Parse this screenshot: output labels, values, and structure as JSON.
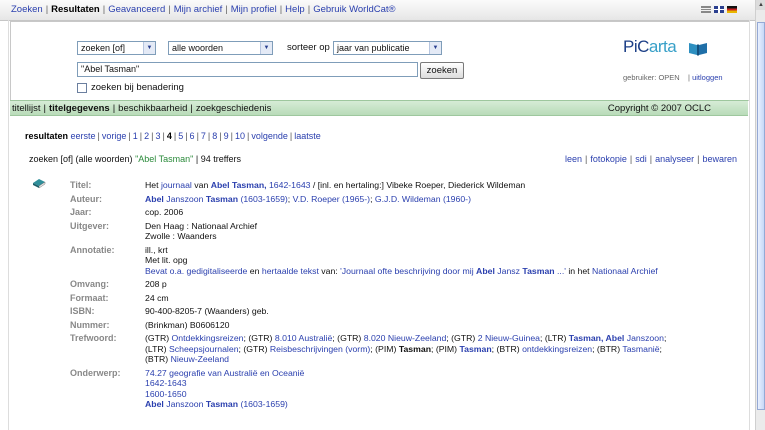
{
  "menu": {
    "items": [
      "Zoeken",
      "Resultaten",
      "Geavanceerd",
      "Mijn archief",
      "Mijn profiel",
      "Help",
      "Gebruik WorldCat®"
    ],
    "current": "Resultaten"
  },
  "search": {
    "mode": "zoeken [of]",
    "words": "alle woorden",
    "sort_label": "sorteer op",
    "sort": "jaar van publicatie",
    "query": "\"Abel Tasman\"",
    "button": "zoeken",
    "approx_label": "zoeken bij benadering"
  },
  "logo": {
    "text_a": "PiC",
    "text_b": "arta"
  },
  "user": {
    "label": "gebruiker:",
    "value": "OPEN",
    "logout": "uitloggen"
  },
  "tabs": [
    "titellijst",
    "titelgegevens",
    "beschikbaarheid",
    "zoekgeschiedenis"
  ],
  "tabs_current": "titelgegevens",
  "copyright": "Copyright © 2007 OCLC",
  "result_nav": {
    "label": "resultaten",
    "first": "eerste",
    "prev": "vorige",
    "pages": [
      "1",
      "2",
      "3",
      "4",
      "5",
      "6",
      "7",
      "8",
      "9",
      "10"
    ],
    "current": "4",
    "next": "volgende",
    "last": "laatste"
  },
  "query_line": {
    "prefix": "zoeken [of] (alle woorden)",
    "query": "\"Abel Tasman\"",
    "hits": "94 treffers"
  },
  "actions": [
    "leen",
    "fotokopie",
    "sdi",
    "analyseer",
    "bewaren"
  ],
  "record": {
    "titel_label": "Titel:",
    "titel": {
      "pre": "Het ",
      "link": "journaal",
      "mid": " van ",
      "b1": "Abel Tasman,",
      "dates": " 1642-1643",
      "post": " / [inl. en hertaling:] Vibeke Roeper, Diederick Wildeman"
    },
    "auteur_label": "Auteur:",
    "auteur": {
      "b1": "Abel",
      "a1": " Janszoon ",
      "b2": "Tasman",
      "a2": " (1603-1659)",
      "sep1": "; ",
      "a3": "V.D. Roeper (1965-)",
      "sep2": "; ",
      "a4": "G.J.D. Wildeman (1960-)"
    },
    "jaar_label": "Jaar:",
    "jaar": "cop. 2006",
    "uitgever_label": "Uitgever:",
    "uitgever": [
      "Den Haag : Nationaal Archief",
      "Zwolle : Waanders"
    ],
    "annotatie_label": "Annotatie:",
    "annotatie": [
      "ill., krt",
      "Met lit. opg"
    ],
    "annotatie_link": {
      "a": "Bevat o.a. gedigitaliseerde",
      "en": " en ",
      "b": "hertaalde tekst",
      "van": " van: ",
      "c1": "'Journaal ofte beschrijving door mij ",
      "cb1": "Abel",
      "c2": " Jansz ",
      "cb2": "Tasman",
      "c3": " ...'",
      "in": " in het ",
      "d": "Nationaal Archief"
    },
    "omvang_label": "Omvang:",
    "omvang": "208 p",
    "formaat_label": "Formaat:",
    "formaat": "24 cm",
    "isbn_label": "ISBN:",
    "isbn": "90-400-8205-7 (Waanders) geb.",
    "nummer_label": "Nummer:",
    "nummer": "(Brinkman) B0606120",
    "trefwoord_label": "Trefwoord:",
    "trefwoord": {
      "t1": "(GTR) ",
      "l1": "Ontdekkingsreizen",
      "t2": "; (GTR) ",
      "l2": "8.010 Australië",
      "t3": "; (GTR) ",
      "l3": "8.020 Nieuw-Zeeland",
      "t4": "; (GTR) ",
      "l4": "2 Nieuw-Guinea",
      "t5": "; (LTR) ",
      "l5b": "Tasman, Abel",
      "l5": " Janszoon",
      "t6": ";",
      "t7": "(LTR) ",
      "l7": "Scheepsjournalen",
      "t8": "; (GTR) ",
      "l8": "Reisbeschrijvingen (vorm)",
      "t9": "; (PIM) ",
      "b9": "Tasman",
      "t10": "; (PIM) ",
      "b10": "Tasman",
      "t11": "; (BTR) ",
      "l11": "ontdekkingsreizen",
      "t12": "; (BTR) ",
      "l12": "Tasmanië",
      "t13": ";",
      "t14": "(BTR) ",
      "l14": "Nieuw-Zeeland"
    },
    "onderwerp_label": "Onderwerp:",
    "onderwerp": [
      "74.27 geografie van Australië en Oceanië",
      "1642-1643",
      "1600-1650"
    ],
    "onderwerp_last": {
      "b1": "Abel",
      "a1": " Janszoon ",
      "b2": "Tasman",
      "a2": " (1603-1659)"
    }
  },
  "colors": {
    "link": "#2a3fae",
    "green_bar": "#c6e3c6",
    "query_green": "#2a8a3a"
  }
}
